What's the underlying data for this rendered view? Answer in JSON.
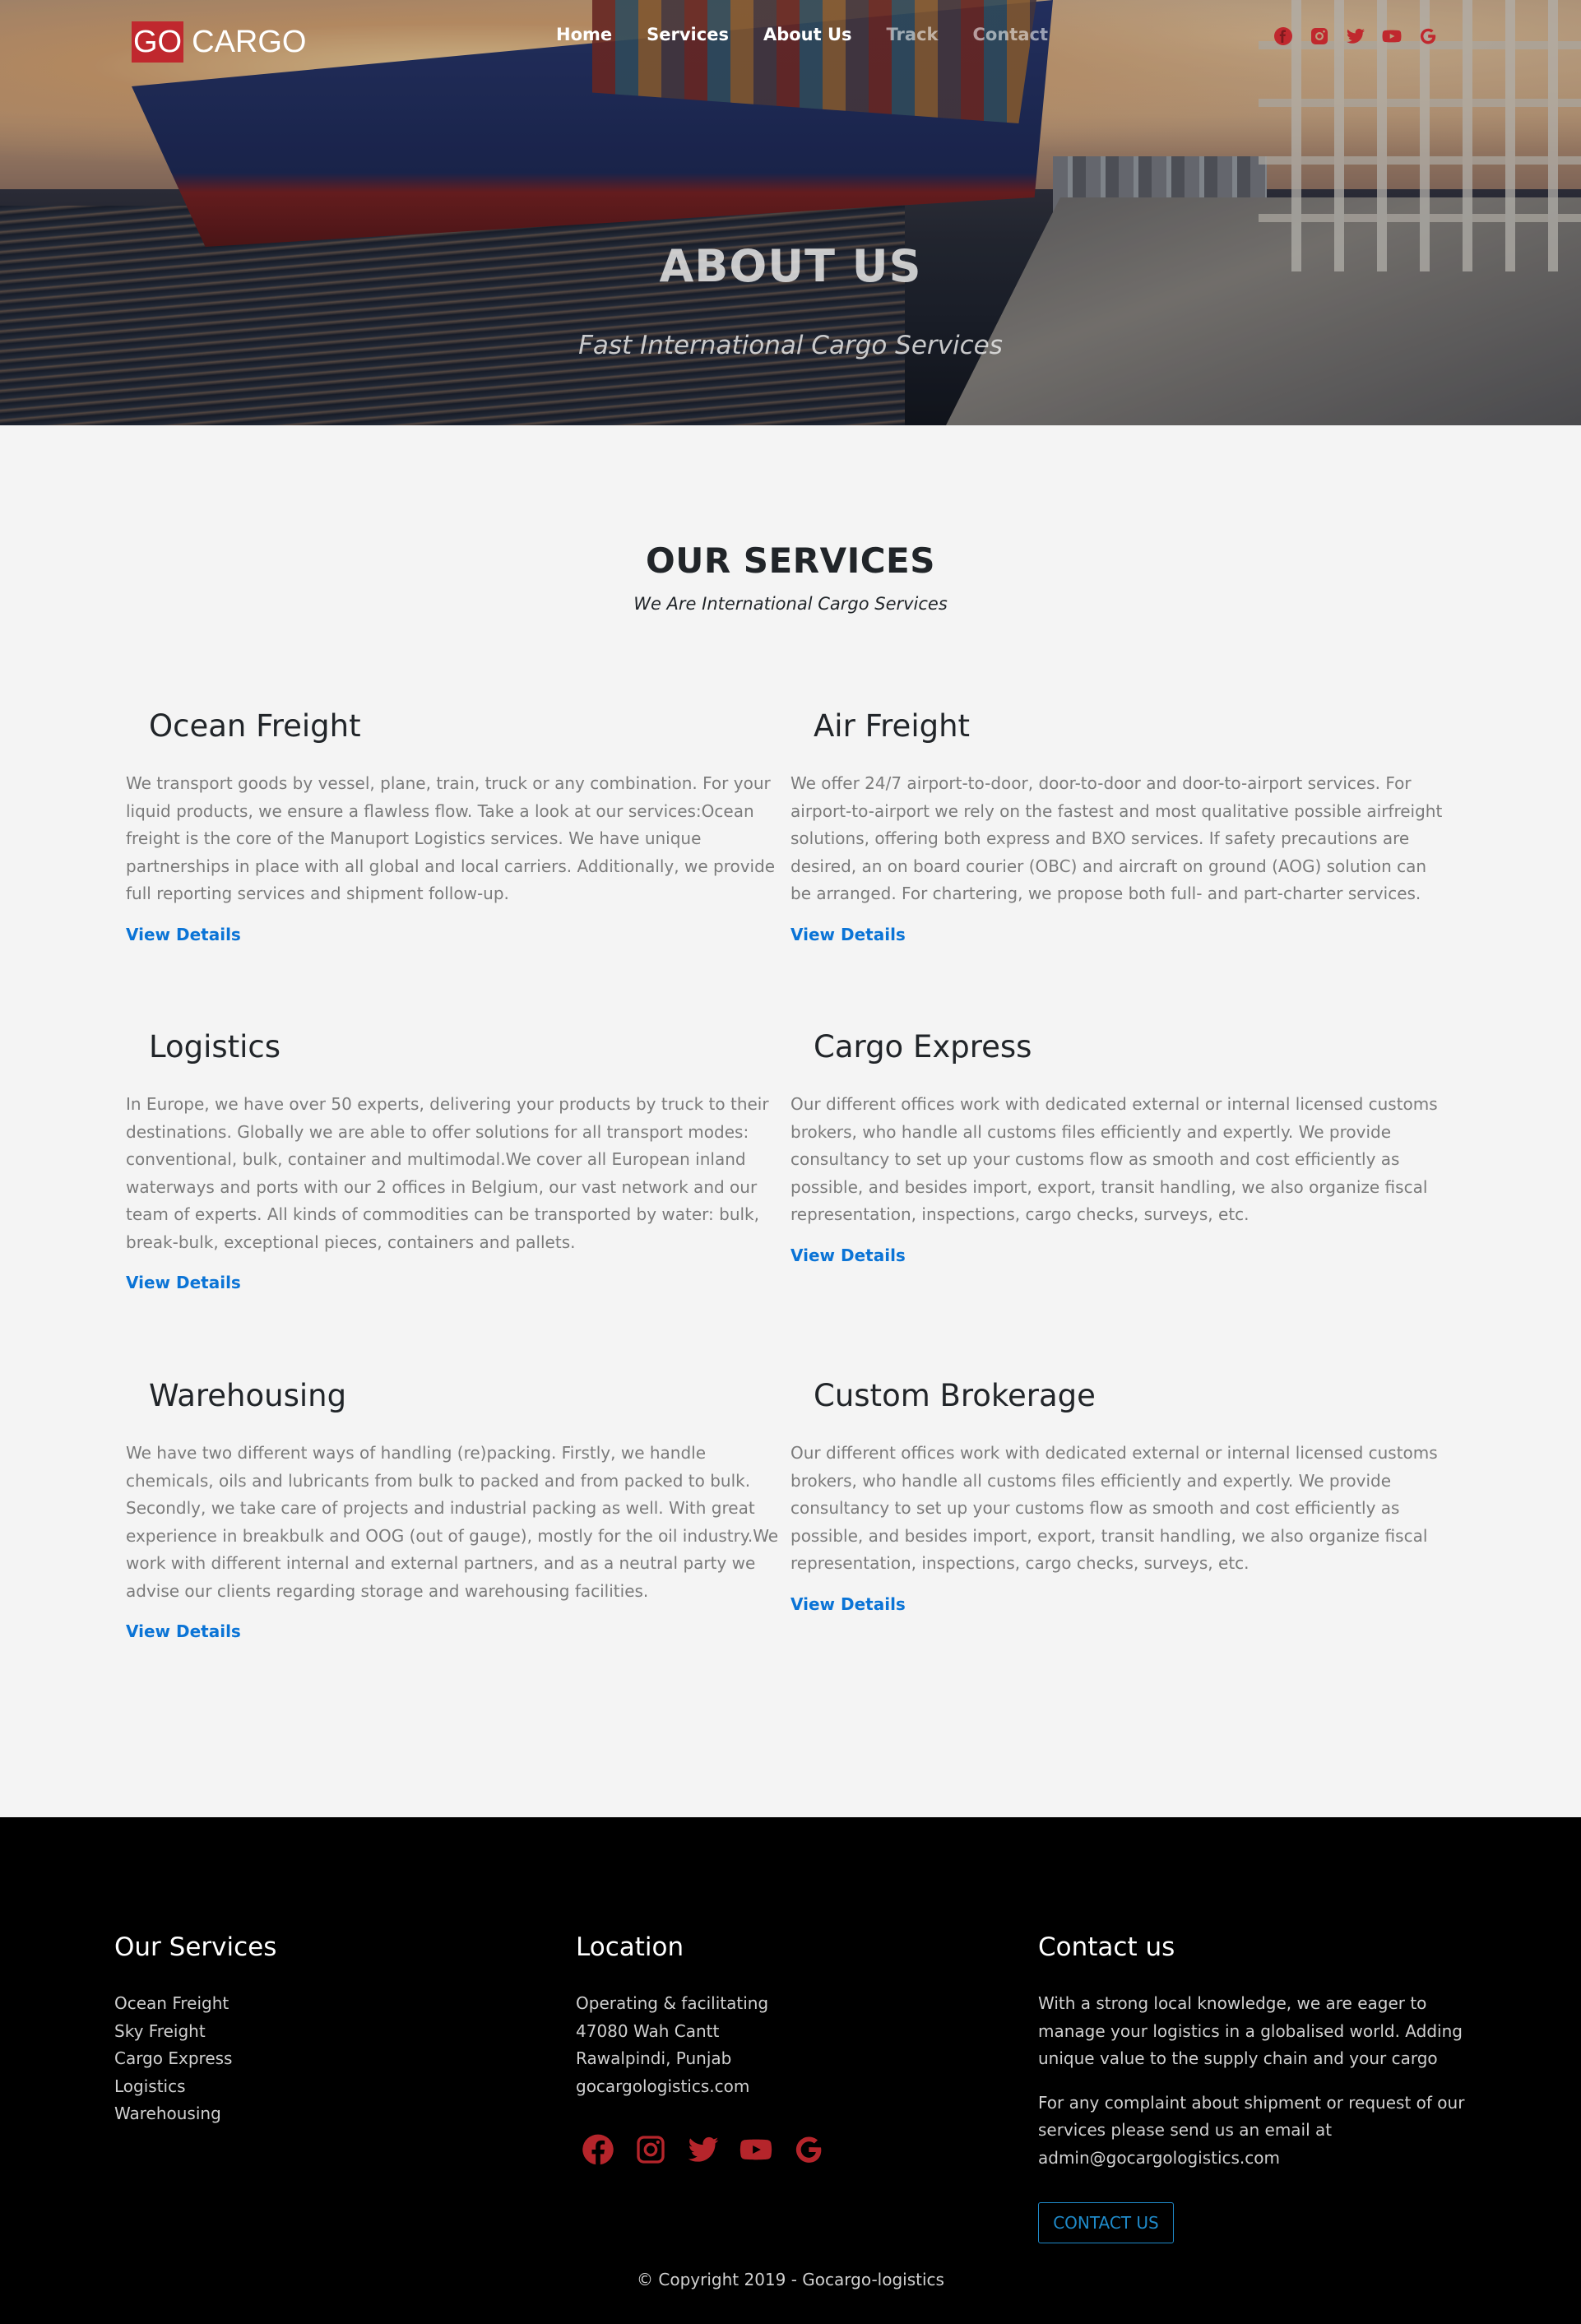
{
  "brand": {
    "go": "GO",
    "cargo": "CARGO"
  },
  "nav": [
    {
      "label": "Home",
      "active": true
    },
    {
      "label": "Services",
      "active": true
    },
    {
      "label": "About Us",
      "active": true
    },
    {
      "label": "Track",
      "active": false
    },
    {
      "label": "Contact",
      "active": false
    }
  ],
  "social_icons": [
    "facebook-icon",
    "instagram-icon",
    "twitter-icon",
    "youtube-icon",
    "google-icon"
  ],
  "hero": {
    "title": "ABOUT US",
    "subtitle": "Fast International Cargo Services"
  },
  "services": {
    "title": "OUR SERVICES",
    "subtitle": "We Are International Cargo Services",
    "link_label": "View Details",
    "items": [
      {
        "title": "Ocean Freight",
        "text": "We transport goods by vessel, plane, train, truck or any combination. For your liquid products, we ensure a flawless flow. Take a look at our services:Ocean freight is the core of the Manuport Logistics services. We have unique partnerships in place with all global and local carriers. Additionally, we provide full reporting services and shipment follow-up."
      },
      {
        "title": "Air Freight",
        "text": "We offer 24/7 airport-to-door, door-to-door and door-to-airport services. For airport-to-airport we rely on the fastest and most qualitative possible airfreight solutions, offering both express and BXO services. If safety precautions are desired, an on board courier (OBC) and aircraft on ground (AOG) solution can be arranged. For chartering, we propose both full- and part-charter services."
      },
      {
        "title": "Logistics",
        "text": "In Europe, we have over 50 experts, delivering your products by truck to their destinations. Globally we are able to offer solutions for all transport modes: conventional, bulk, container and multimodal.We cover all European inland waterways and ports with our 2 offices in Belgium, our vast network and our team of experts. All kinds of commodities can be transported by water: bulk, break-bulk, exceptional pieces, containers and pallets."
      },
      {
        "title": "Cargo Express",
        "text": "Our different offices work with dedicated external or internal licensed customs brokers, who handle all customs files efficiently and expertly. We provide consultancy to set up your customs flow as smooth and cost efficiently as possible, and besides import, export, transit handling, we also organize fiscal representation, inspections, cargo checks, surveys, etc."
      },
      {
        "title": "Warehousing",
        "text": "We have two different ways of handling (re)packing. Firstly, we handle chemicals, oils and lubricants from bulk to packed and from packed to bulk. Secondly, we take care of projects and industrial packing as well. With great experience in breakbulk and OOG (out of gauge), mostly for the oil industry.We work with different internal and external partners, and as a neutral party we advise our clients regarding storage and warehousing facilities."
      },
      {
        "title": "Custom Brokerage",
        "text": "Our different offices work with dedicated external or internal licensed customs brokers, who handle all customs files efficiently and expertly. We provide consultancy to set up your customs flow as smooth and cost efficiently as possible, and besides import, export, transit handling, we also organize fiscal representation, inspections, cargo checks, surveys, etc."
      }
    ]
  },
  "footer": {
    "services": {
      "title": "Our Services",
      "items": [
        "Ocean Freight",
        "Sky Freight",
        "Cargo Express",
        "Logistics",
        "Warehousing"
      ]
    },
    "location": {
      "title": "Location",
      "lines": [
        "Operating & facilitating",
        "47080 Wah Cantt",
        "Rawalpindi, Punjab",
        "gocargologistics.com"
      ]
    },
    "contact": {
      "title": "Contact us",
      "p1": "With a strong local knowledge, we are eager to manage your logistics in a globalised world. Adding unique value to the supply chain and your cargo",
      "p2": "For any complaint about shipment or request of our services please send us an email at admin@gocargologistics.com",
      "button": "CONTACT US"
    },
    "copyright": "© Copyright 2019 - Gocargo-logistics"
  },
  "colors": {
    "brand_red": "#c0282e",
    "link_blue": "#0b74d6",
    "footer_bg": "#000000"
  }
}
